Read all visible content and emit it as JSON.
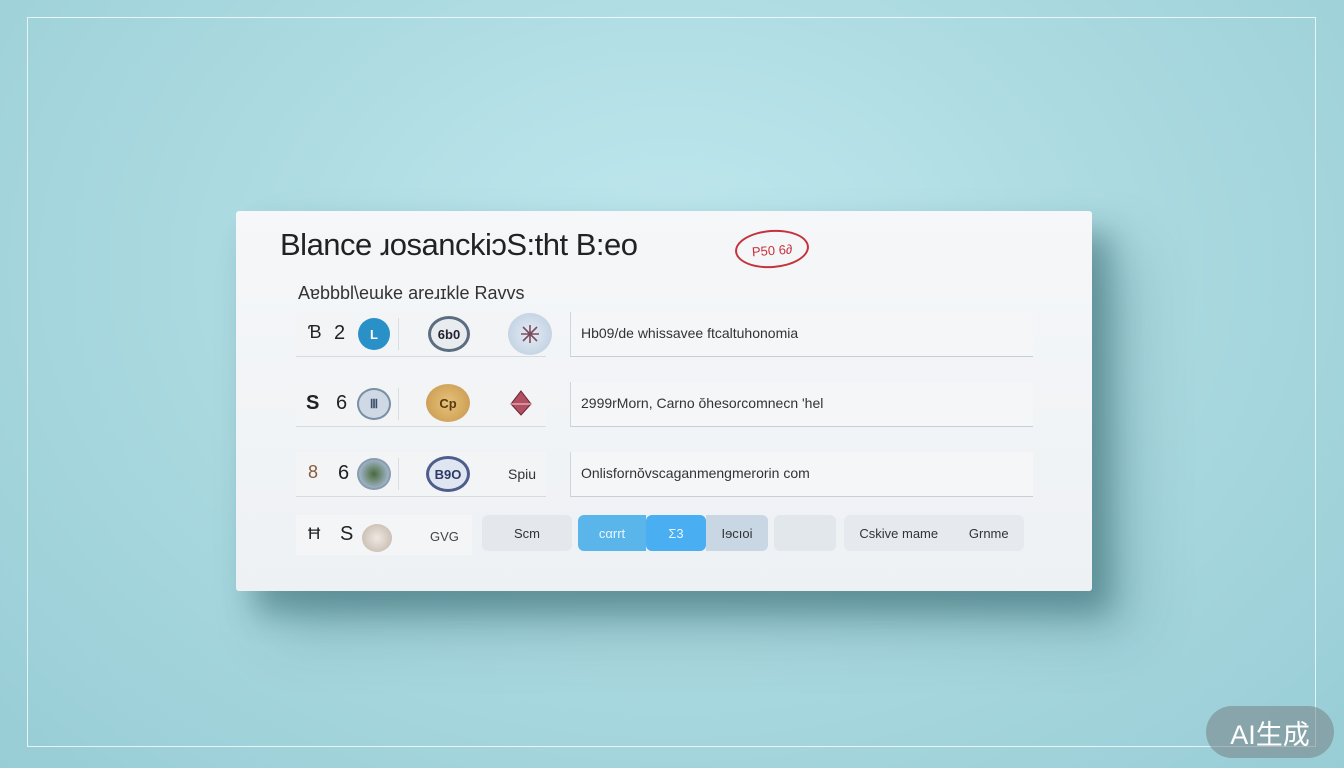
{
  "card": {
    "title": "Blance ɹosanckiɔS:tht B:eo",
    "stamp": "P50 6∂",
    "subtitle": "Aɐbbbl\\eɯke areɹɪkle Ravvs"
  },
  "rows": [
    {
      "glyph_a": "Ɓ",
      "glyph_b": "2",
      "coin_a": "L",
      "coin_b": "6b0",
      "description": "Hb09/de whissaveе ftcaltuhonomia"
    },
    {
      "glyph_a": "S",
      "glyph_b": "6",
      "coin_a": "Ⅲ",
      "coin_b": "Cp",
      "description": "2999rMorn, Carno ŏhesoɾcomnecn 'hel"
    },
    {
      "glyph_a": "8",
      "glyph_b": "6",
      "coin_a": "",
      "coin_b": "B9O",
      "label": "Spiu",
      "description": "Onlisfornŏvscaganmengmerorin com"
    }
  ],
  "action_row": {
    "glyph_a": "Ħ",
    "glyph_b": "S",
    "label_gve": "GVG",
    "buttons": {
      "scm": "Scm",
      "seg_left": "cαrrt",
      "seg_mid": "Ʃ3",
      "seg_right": "Iɘcıoi",
      "blank": "",
      "cskiv": "Cskive mame",
      "orname": "Grnme"
    }
  },
  "colors": {
    "accent": "#5ab6ea",
    "stamp": "#c4333d",
    "background": "#a9d8df"
  },
  "watermark": "AI生成"
}
